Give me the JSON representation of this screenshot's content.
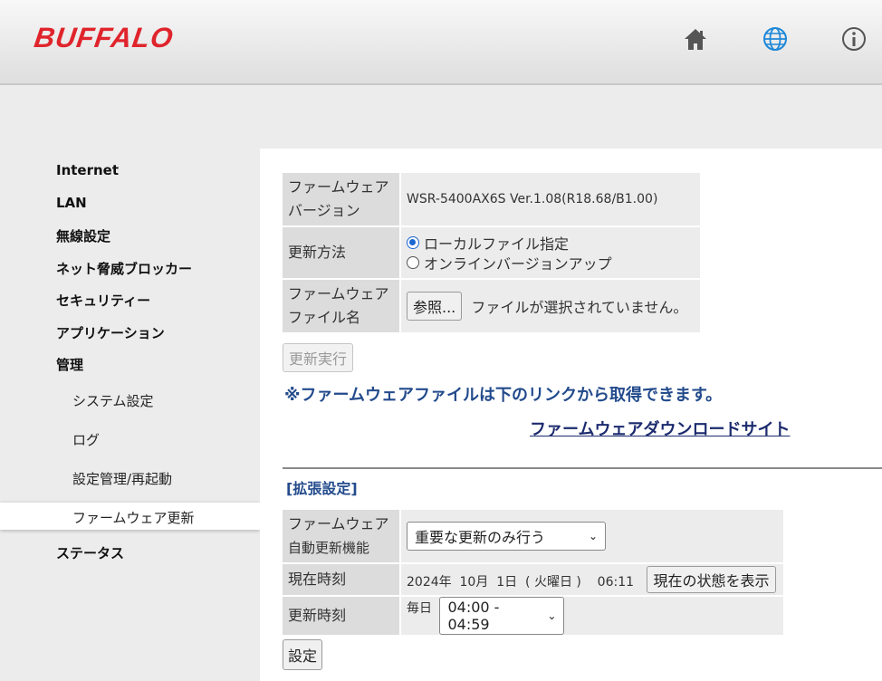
{
  "header": {
    "logo": "BUFFALO",
    "icons": [
      "home-icon",
      "globe-icon",
      "info-icon"
    ]
  },
  "sidebar": {
    "items": [
      {
        "label": "Internet"
      },
      {
        "label": "LAN"
      },
      {
        "label": "無線設定"
      },
      {
        "label": "ネット脅威ブロッカー"
      },
      {
        "label": "セキュリティー"
      },
      {
        "label": "アプリケーション"
      },
      {
        "label": "管理"
      },
      {
        "label": "ステータス"
      }
    ],
    "sub_items": [
      {
        "label": "システム設定"
      },
      {
        "label": "ログ"
      },
      {
        "label": "設定管理/再起動"
      },
      {
        "label": "ファームウェア更新",
        "active": true
      }
    ]
  },
  "firmware": {
    "version_label_1": "ファームウェア",
    "version_label_2": "バージョン",
    "version_value": "WSR-5400AX6S Ver.1.08(R18.68/B1.00)",
    "method_label": "更新方法",
    "method_options": [
      "ローカルファイル指定",
      "オンラインバージョンアップ"
    ],
    "method_selected": "ローカルファイル指定",
    "file_label_1": "ファームウェア",
    "file_label_2": "ファイル名",
    "browse_button": "参照...",
    "file_status": "ファイルが選択されていません。",
    "execute_button": "更新実行",
    "notice": "※ファームウェアファイルは下のリンクから取得できます。",
    "download_link": "ファームウェアダウンロードサイト"
  },
  "advanced": {
    "title": "[拡張設定]",
    "auto_label_1": "ファームウェア",
    "auto_label_2": "自動更新機能",
    "auto_value": "重要な更新のみ行う",
    "time_label": "現在時刻",
    "time_value": "2024年  10月  1日  ( 火曜日 )    06:11",
    "show_status_button": "現在の状態を表示",
    "update_time_label": "更新時刻",
    "update_time_prefix": "毎日",
    "update_time_value": "04:00 - 04:59",
    "submit_button": "設定"
  },
  "colors": {
    "brand": "#e0242c",
    "accent_text": "#234b8c",
    "radio": "#1a66d2"
  }
}
